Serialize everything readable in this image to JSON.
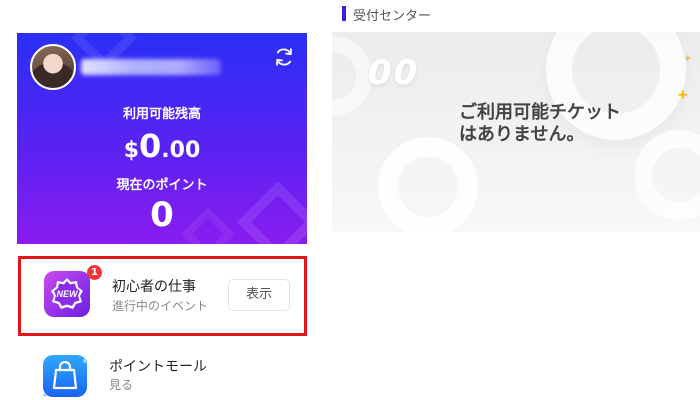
{
  "balance_card": {
    "balance_label": "利用可能残高",
    "currency": "$",
    "amount_int": "0",
    "amount_dec": ".00",
    "points_label": "現在のポイント",
    "points_value": "0"
  },
  "tasks": {
    "newbie": {
      "badge_text": "NEW",
      "notification_count": "1",
      "title": "初心者の仕事",
      "subtitle": "進行中のイベント",
      "button_label": "表示"
    },
    "mall": {
      "title": "ポイントモール",
      "subtitle": "見る"
    }
  },
  "reception": {
    "section_title": "受付センター",
    "decor_text": "00",
    "empty_line_1": "ご利用可能チケット",
    "empty_line_2": "はありません。"
  },
  "colors": {
    "card_gradient_top": "#2a2ff7",
    "card_gradient_bottom": "#8a1cf0",
    "highlight_border": "#e4141b",
    "section_accent": "#3a21d6",
    "notification_badge": "#f2353b"
  },
  "icons": [
    "refresh-icon",
    "new-badge-icon",
    "shopping-bag-icon"
  ]
}
